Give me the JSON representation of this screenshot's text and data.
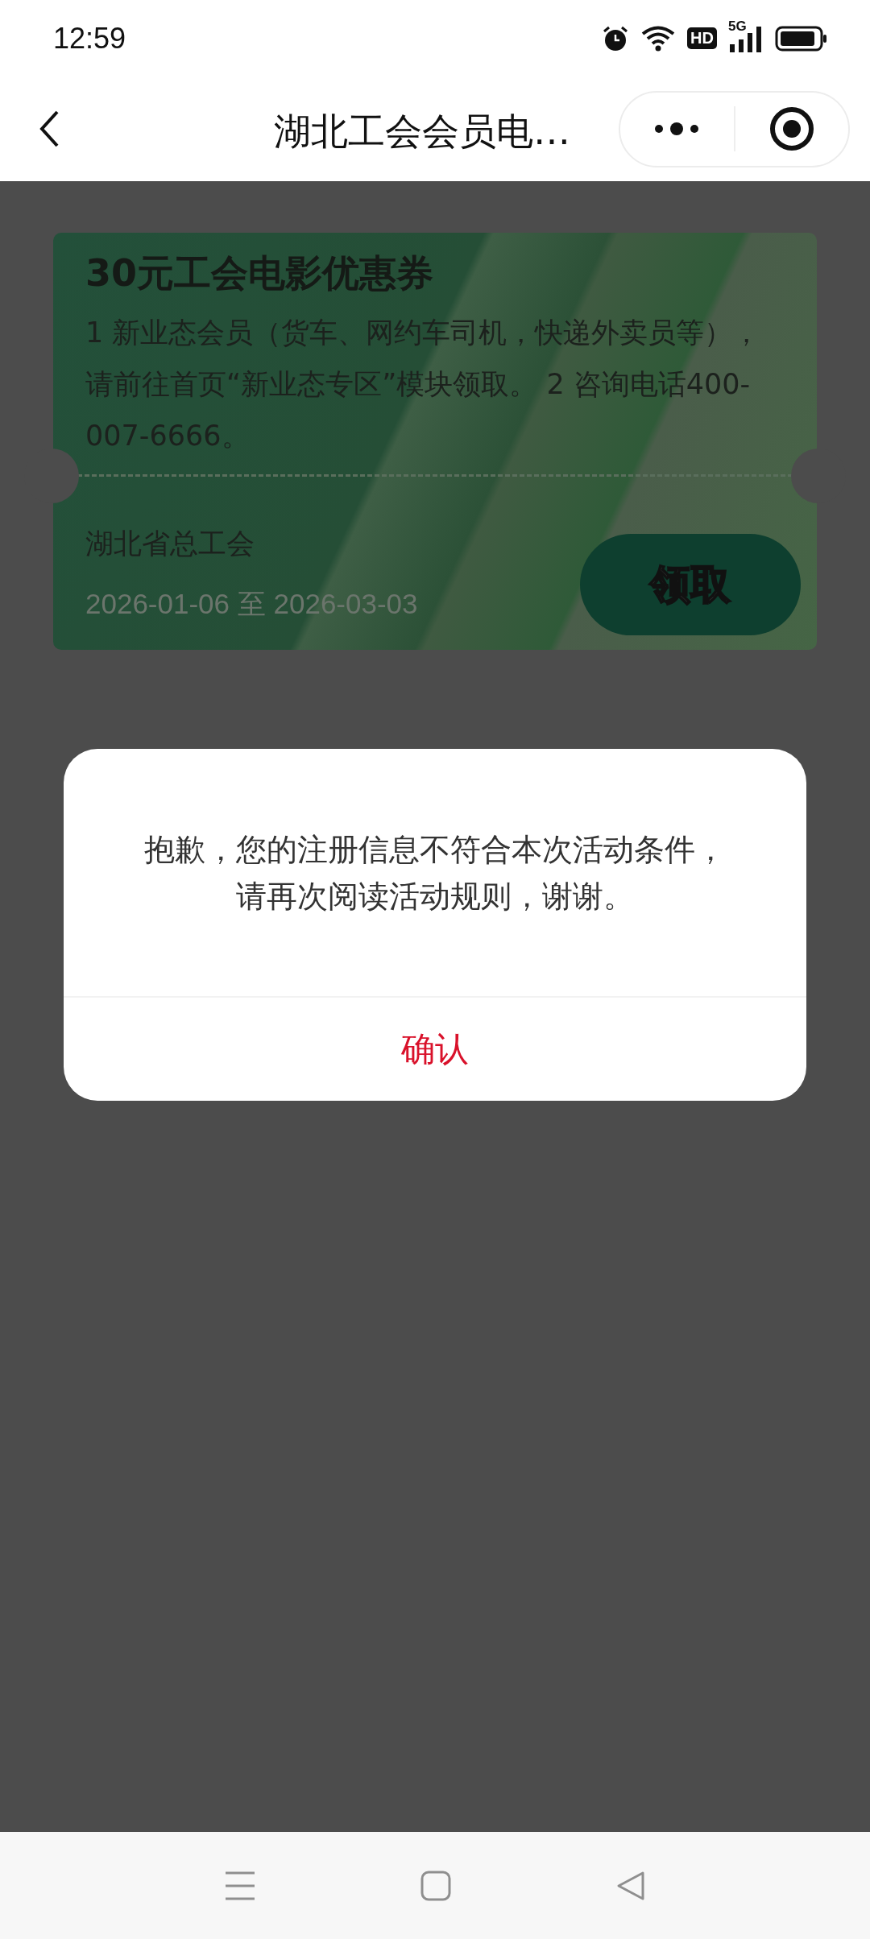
{
  "status_bar": {
    "time": "12:59",
    "hd_badge": "HD",
    "network": "5G"
  },
  "header": {
    "title": "湖北工会会员电…"
  },
  "coupon": {
    "title": "30元工会电影优惠券",
    "description": "1 新业态会员（货车、网约车司机，快递外卖员等），请前往首页“新业态专区”模块领取。 2 咨询电话400-007-6666。",
    "issuer": "湖北省总工会",
    "validity": "2026-01-06 至 2026-03-03",
    "claim_button": "领取"
  },
  "dialog": {
    "message": "抱歉，您的注册信息不符合本次活动条件，请再次阅读活动规则，谢谢。",
    "confirm_button": "确认"
  }
}
